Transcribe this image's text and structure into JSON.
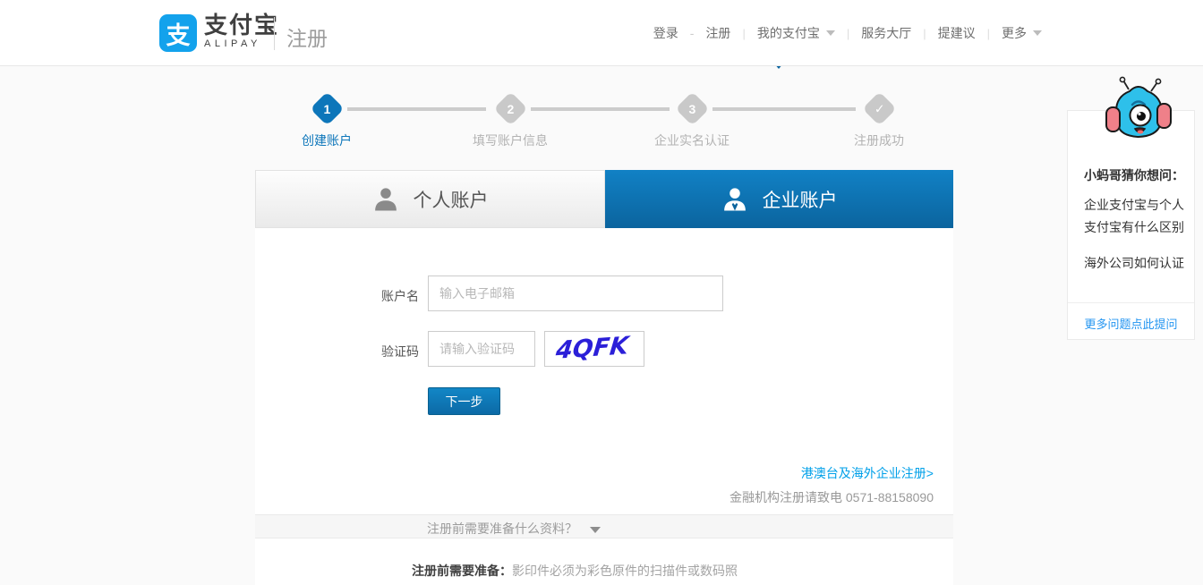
{
  "header": {
    "logo_glyph": "支",
    "brand_cn": "支付宝",
    "brand_en": "ALIPAY",
    "page_label": "注册",
    "nav": {
      "login": "登录",
      "dash": "-",
      "register": "注册",
      "my_alipay": "我的支付宝",
      "service_hall": "服务大厅",
      "feedback": "提建议",
      "more": "更多"
    }
  },
  "steps": {
    "items": [
      {
        "marker": "1",
        "label": "创建账户",
        "state": "active"
      },
      {
        "marker": "2",
        "label": "填写账户信息",
        "state": "pending"
      },
      {
        "marker": "3",
        "label": "企业实名认证",
        "state": "pending"
      },
      {
        "marker": "✓",
        "label": "注册成功",
        "state": "pending"
      }
    ]
  },
  "tabs": {
    "personal": "个人账户",
    "enterprise": "企业账户",
    "active": "企业账户"
  },
  "form": {
    "account_label": "账户名",
    "account_placeholder": "输入电子邮箱",
    "account_value": "",
    "captcha_label": "验证码",
    "captcha_placeholder": "请输入验证码",
    "captcha_value": "",
    "captcha_image_text": "4QFK",
    "next_button": "下一步",
    "overseas_link": "港澳台及海外企业注册>",
    "finance_note": "金融机构注册请致电 0571-88158090"
  },
  "accordion": {
    "question": "注册前需要准备什么资料？"
  },
  "prep": {
    "prefix": "注册前需要准备：",
    "text": "影印件必须为彩色原件的扫描件或数码照"
  },
  "helper": {
    "title": "小蚂哥猜你想问：",
    "questions": [
      "企业支付宝与个人支付宝有什么区别",
      "海外公司如何认证"
    ],
    "more_link": "更多问题点此提问"
  },
  "colors": {
    "brand_logo_blue": "#13a2ec",
    "active_tab_blue": "#0d6fae",
    "step_active_blue": "#0d76ba",
    "link_blue": "#00a0e9",
    "helper_link_blue": "#2395f1",
    "captcha_ink_blue": "#2b1fd8",
    "page_background": "#fafafa"
  }
}
